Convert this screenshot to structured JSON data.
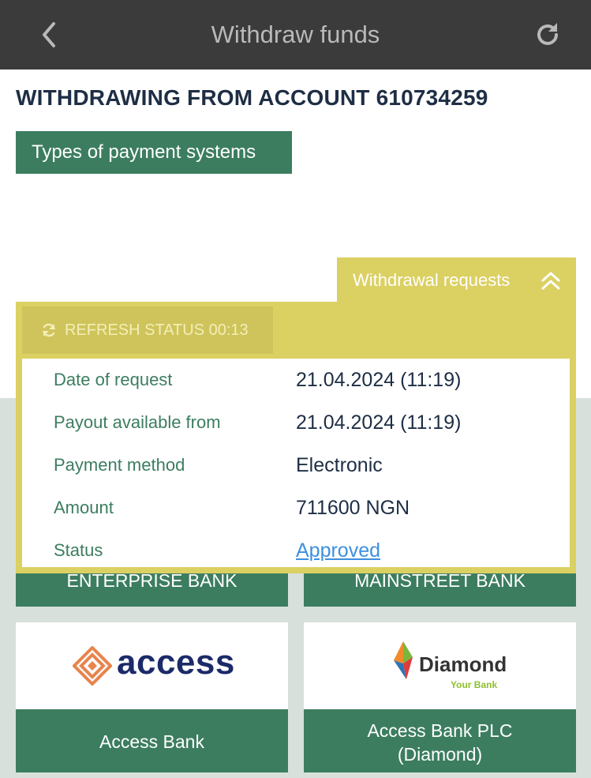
{
  "header": {
    "title": "Withdraw funds",
    "back_icon": "chevron-left-icon",
    "refresh_icon": "refresh-icon"
  },
  "page": {
    "heading": "WITHDRAWING FROM ACCOUNT 610734259",
    "types_button": "Types of payment systems"
  },
  "withdrawal_requests": {
    "tab_label": "Withdrawal requests",
    "tab_icon": "double-chevron-up-icon",
    "refresh_status": "REFRESH STATUS 00:13",
    "rows": [
      {
        "key": "Date of request",
        "value": "21.04.2024 (11:19)"
      },
      {
        "key": "Payout available from",
        "value": "21.04.2024 (11:19)"
      },
      {
        "key": "Payment method",
        "value": "Electronic"
      },
      {
        "key": "Amount",
        "value": "711600 NGN"
      },
      {
        "key": "Status",
        "value": "Approved"
      }
    ]
  },
  "banks": [
    {
      "label": "ENTERPRISE BANK"
    },
    {
      "label": "MAINSTREET BANK"
    },
    {
      "label": "Access Bank",
      "logo_text": "access"
    },
    {
      "label": "Access Bank PLC (Diamond)",
      "logo_text": "Diamond",
      "logo_tagline": "Your Bank"
    }
  ],
  "colors": {
    "header_bg": "#3b3b3b",
    "accent_green": "#3c7d60",
    "panel_yellow": "#dbd062",
    "link_blue": "#3d8fe0",
    "access_orange": "#e8844c",
    "access_navy": "#1b2a68"
  }
}
